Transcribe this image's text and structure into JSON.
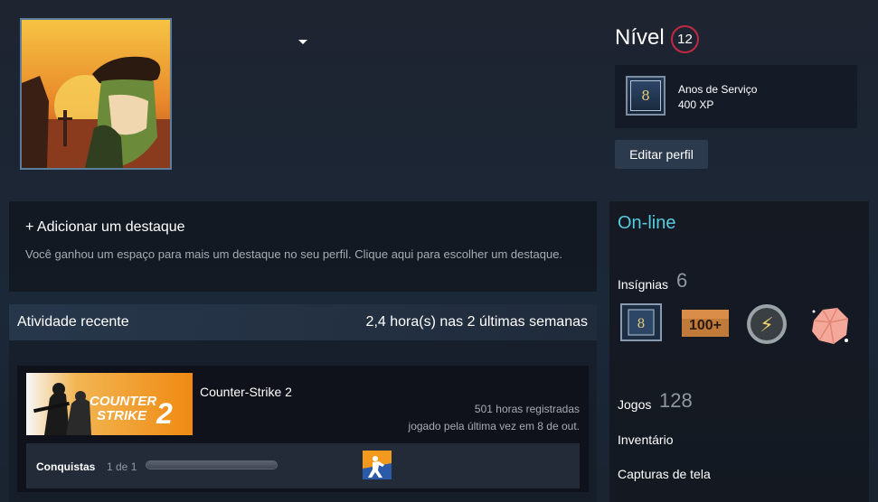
{
  "profile": {
    "level_label": "Nível",
    "level": "12",
    "service_badge_glyph": "8",
    "service_title": "Anos de Serviço",
    "service_xp": "400 XP",
    "edit_button": "Editar perfil"
  },
  "showcase": {
    "title": "+ Adicionar um destaque",
    "description": "Você ganhou um espaço para mais um destaque no seu perfil. Clique aqui para escolher um destaque."
  },
  "activity": {
    "title": "Atividade recente",
    "hours_summary": "2,4 hora(s) nas 2 últimas semanas",
    "game": {
      "name": "Counter-Strike 2",
      "capsule_line1": "COUNTER",
      "capsule_line2": "STRIKE",
      "capsule_number": "2",
      "hours": "501 horas registradas",
      "last_played": "jogado pela última vez em 8 de out.",
      "achievements_label": "Conquistas",
      "achievements_count": "1 de 1",
      "achievements_progress": 1.0,
      "achievement_icon": "counter-terrorist-icon"
    }
  },
  "sidebar": {
    "status": "On-line",
    "badges_label": "Insígnias",
    "badges_count": "6",
    "badge_icons": [
      "years-of-service-icon",
      "100-plus-icon",
      "lightning-coin-icon",
      "pink-gem-icon"
    ],
    "badge_glyphs": {
      "years": "8",
      "hundred": "100+",
      "bolt": "⚡"
    },
    "games_label": "Jogos",
    "games_count": "128",
    "inventory": "Inventário",
    "screenshots": "Capturas de tela"
  },
  "colors": {
    "status_online": "#57cbde",
    "level_ring": "#c02942",
    "cs2_orange": "#f39a1e"
  }
}
